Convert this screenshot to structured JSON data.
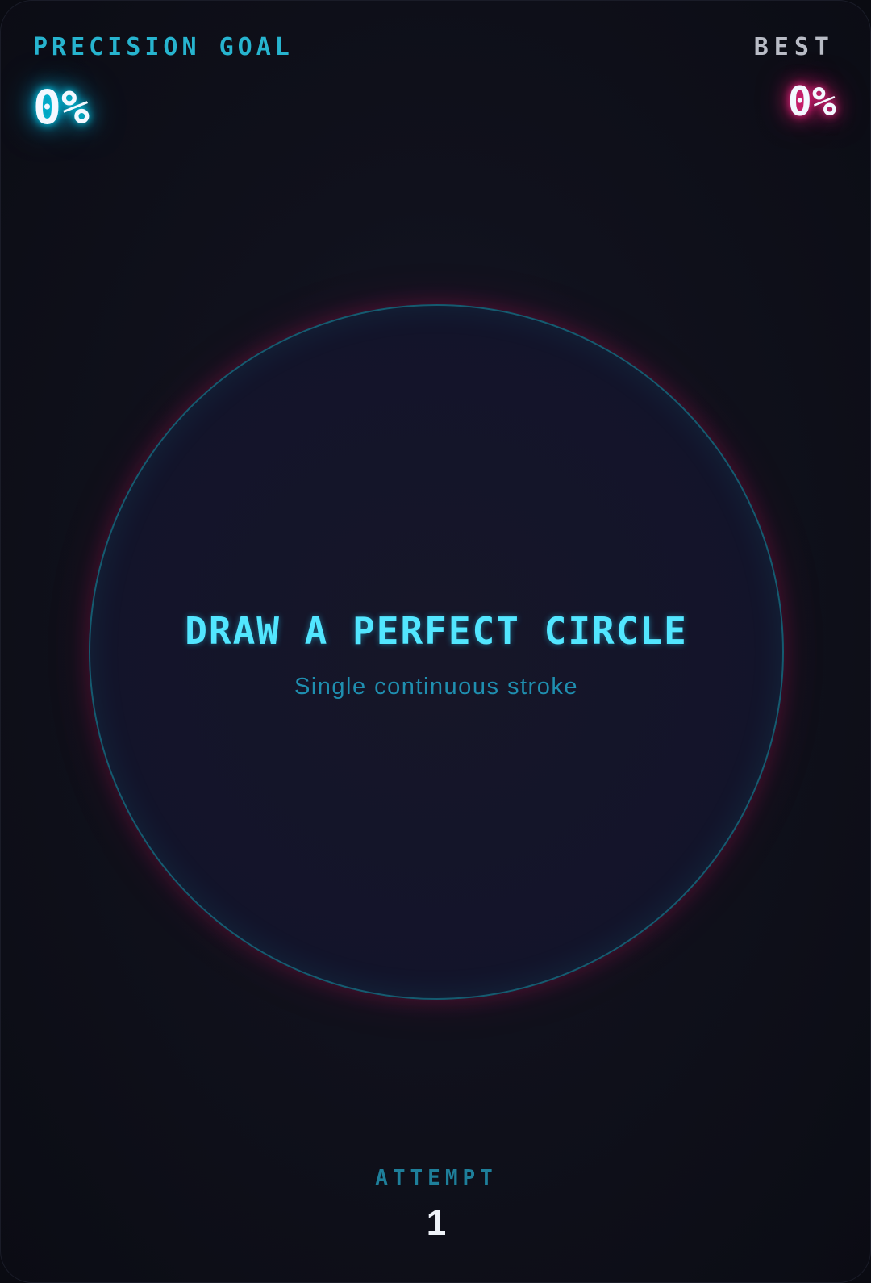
{
  "hud": {
    "goal_label": "PRECISION GOAL",
    "goal_value": "0%",
    "best_label": "BEST",
    "best_value": "0%"
  },
  "prompt": {
    "title": "DRAW A PERFECT CIRCLE",
    "subtitle": "Single continuous stroke"
  },
  "attempt": {
    "label": "ATTEMPT",
    "value": "1"
  },
  "colors": {
    "accent_cyan": "#52e6ff",
    "accent_pink": "#ff2a8a",
    "background": "#10111c"
  }
}
